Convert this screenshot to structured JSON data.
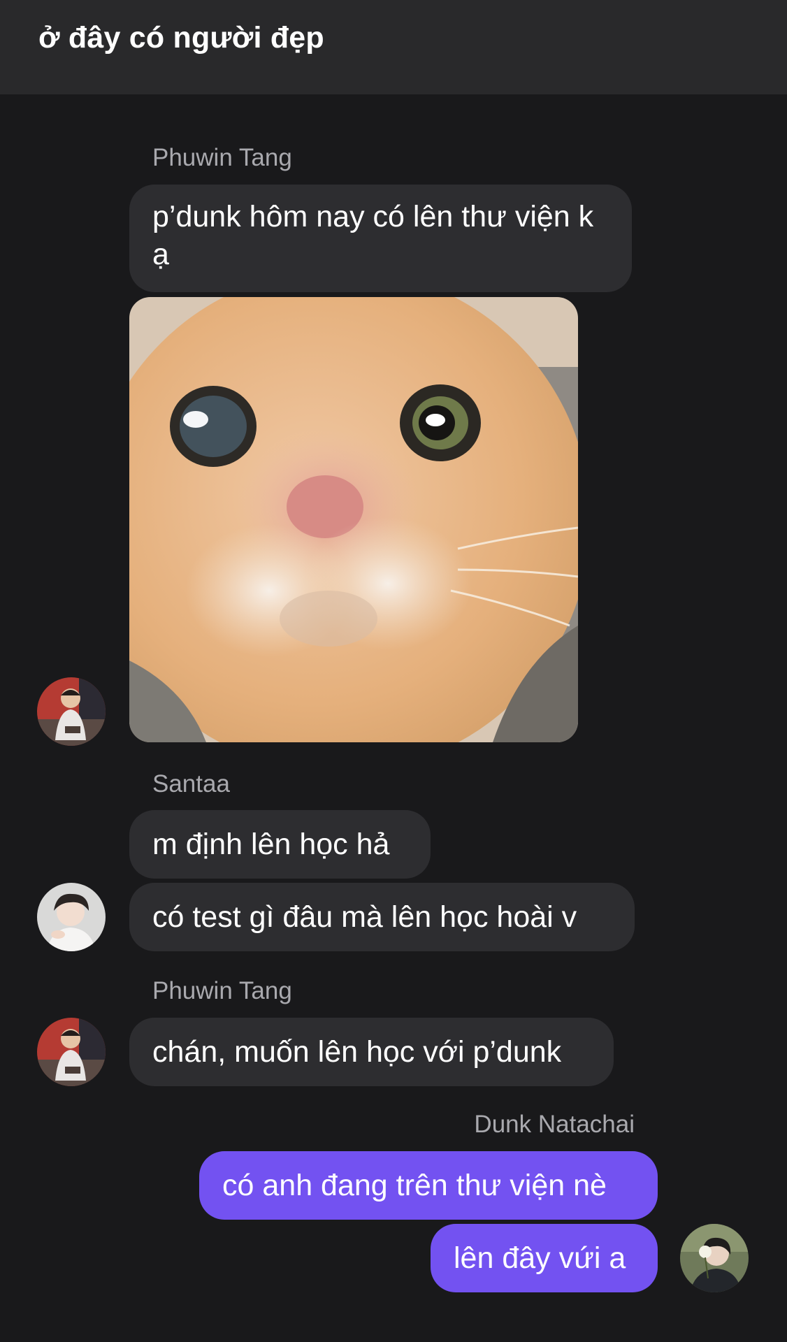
{
  "chat": {
    "title": "ở đây có người đẹp"
  },
  "messages": [
    {
      "sender": "Phuwin Tang",
      "text": "p’dunk hôm nay có lên thư viện k ạ"
    },
    {
      "sender": "Santaa",
      "text": "m định lên học hả"
    },
    {
      "text": "có test gì đâu mà lên học hoài v"
    },
    {
      "sender": "Phuwin Tang",
      "text": "chán, muốn lên học với p’dunk"
    },
    {
      "sender": "Dunk Natachai",
      "text": "có anh đang trên thư viện nè"
    },
    {
      "text": "lên đây vứi a"
    }
  ],
  "colors": {
    "background": "#19191b",
    "header": "#29292b",
    "incoming_bubble": "#2d2d30",
    "outgoing_bubble": "#7352f1",
    "sender_name": "#a9a9ae"
  },
  "icons": {
    "photo": "cat-photo",
    "avatars": [
      "phuwin-avatar",
      "santaa-avatar",
      "dunk-avatar"
    ]
  }
}
